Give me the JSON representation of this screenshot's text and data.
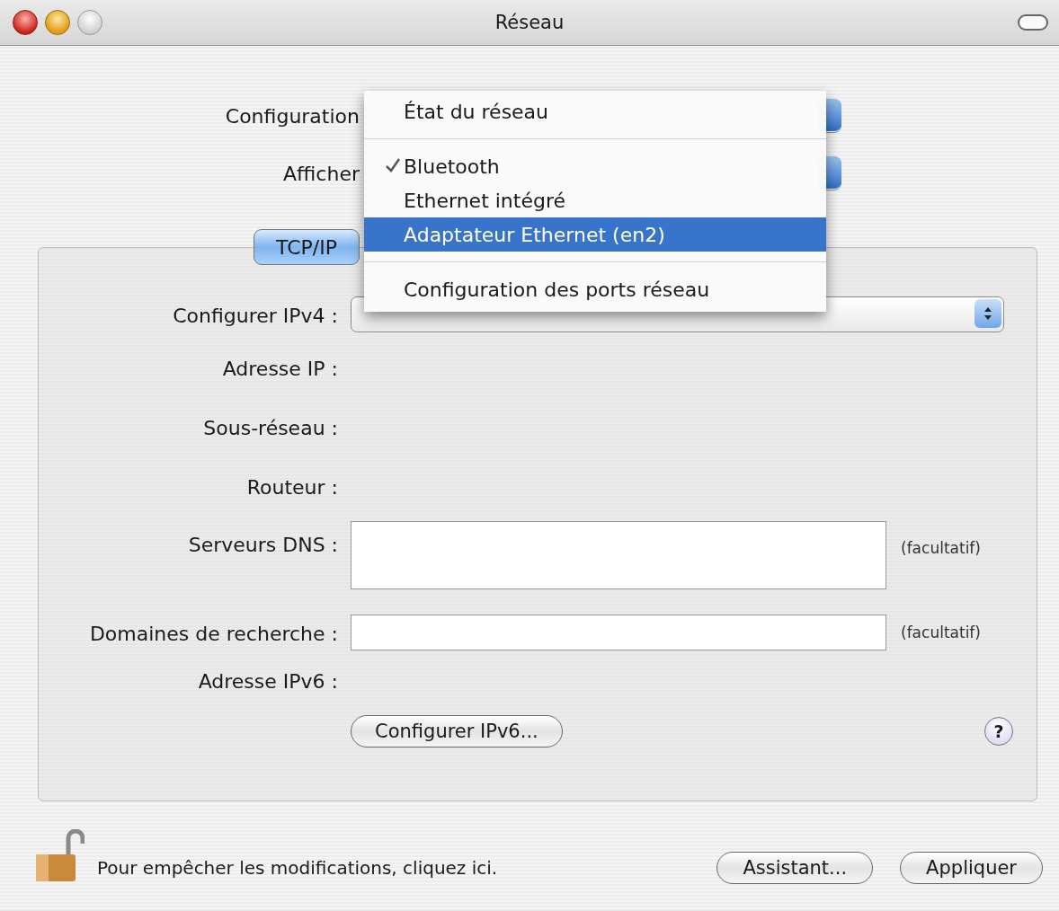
{
  "window": {
    "title": "Réseau"
  },
  "top_rows": [
    {
      "label": "Configuration"
    },
    {
      "label": "Afficher"
    }
  ],
  "tabs": [
    {
      "label": "TCP/IP",
      "selected": true
    }
  ],
  "popup_menu": {
    "items": [
      {
        "label": "État du réseau",
        "checked": false,
        "selected": false,
        "separator_after": true
      },
      {
        "label": "Bluetooth",
        "checked": true,
        "selected": false,
        "separator_after": false
      },
      {
        "label": "Ethernet intégré",
        "checked": false,
        "selected": false,
        "separator_after": false
      },
      {
        "label": "Adaptateur Ethernet (en2)",
        "checked": false,
        "selected": true,
        "separator_after": true
      },
      {
        "label": "Configuration des ports réseau",
        "checked": false,
        "selected": false,
        "separator_after": false
      }
    ]
  },
  "form": [
    {
      "kind": "popup",
      "label": "Configurer IPv4 :"
    },
    {
      "kind": "static",
      "label": "Adresse IP :"
    },
    {
      "kind": "static",
      "label": "Sous-réseau :"
    },
    {
      "kind": "static",
      "label": "Routeur :"
    },
    {
      "kind": "textarea",
      "label": "Serveurs DNS :",
      "note": "(facultatif)"
    },
    {
      "kind": "text",
      "label": "Domaines de recherche :",
      "note": "(facultatif)"
    },
    {
      "kind": "static",
      "label": "Adresse IPv6 :"
    },
    {
      "kind": "button",
      "label": "Configurer IPv6...",
      "help": "?"
    }
  ],
  "footer": {
    "lock_text": "Pour empêcher les modifications, cliquez ici.",
    "buttons": [
      "Assistant...",
      "Appliquer"
    ]
  }
}
